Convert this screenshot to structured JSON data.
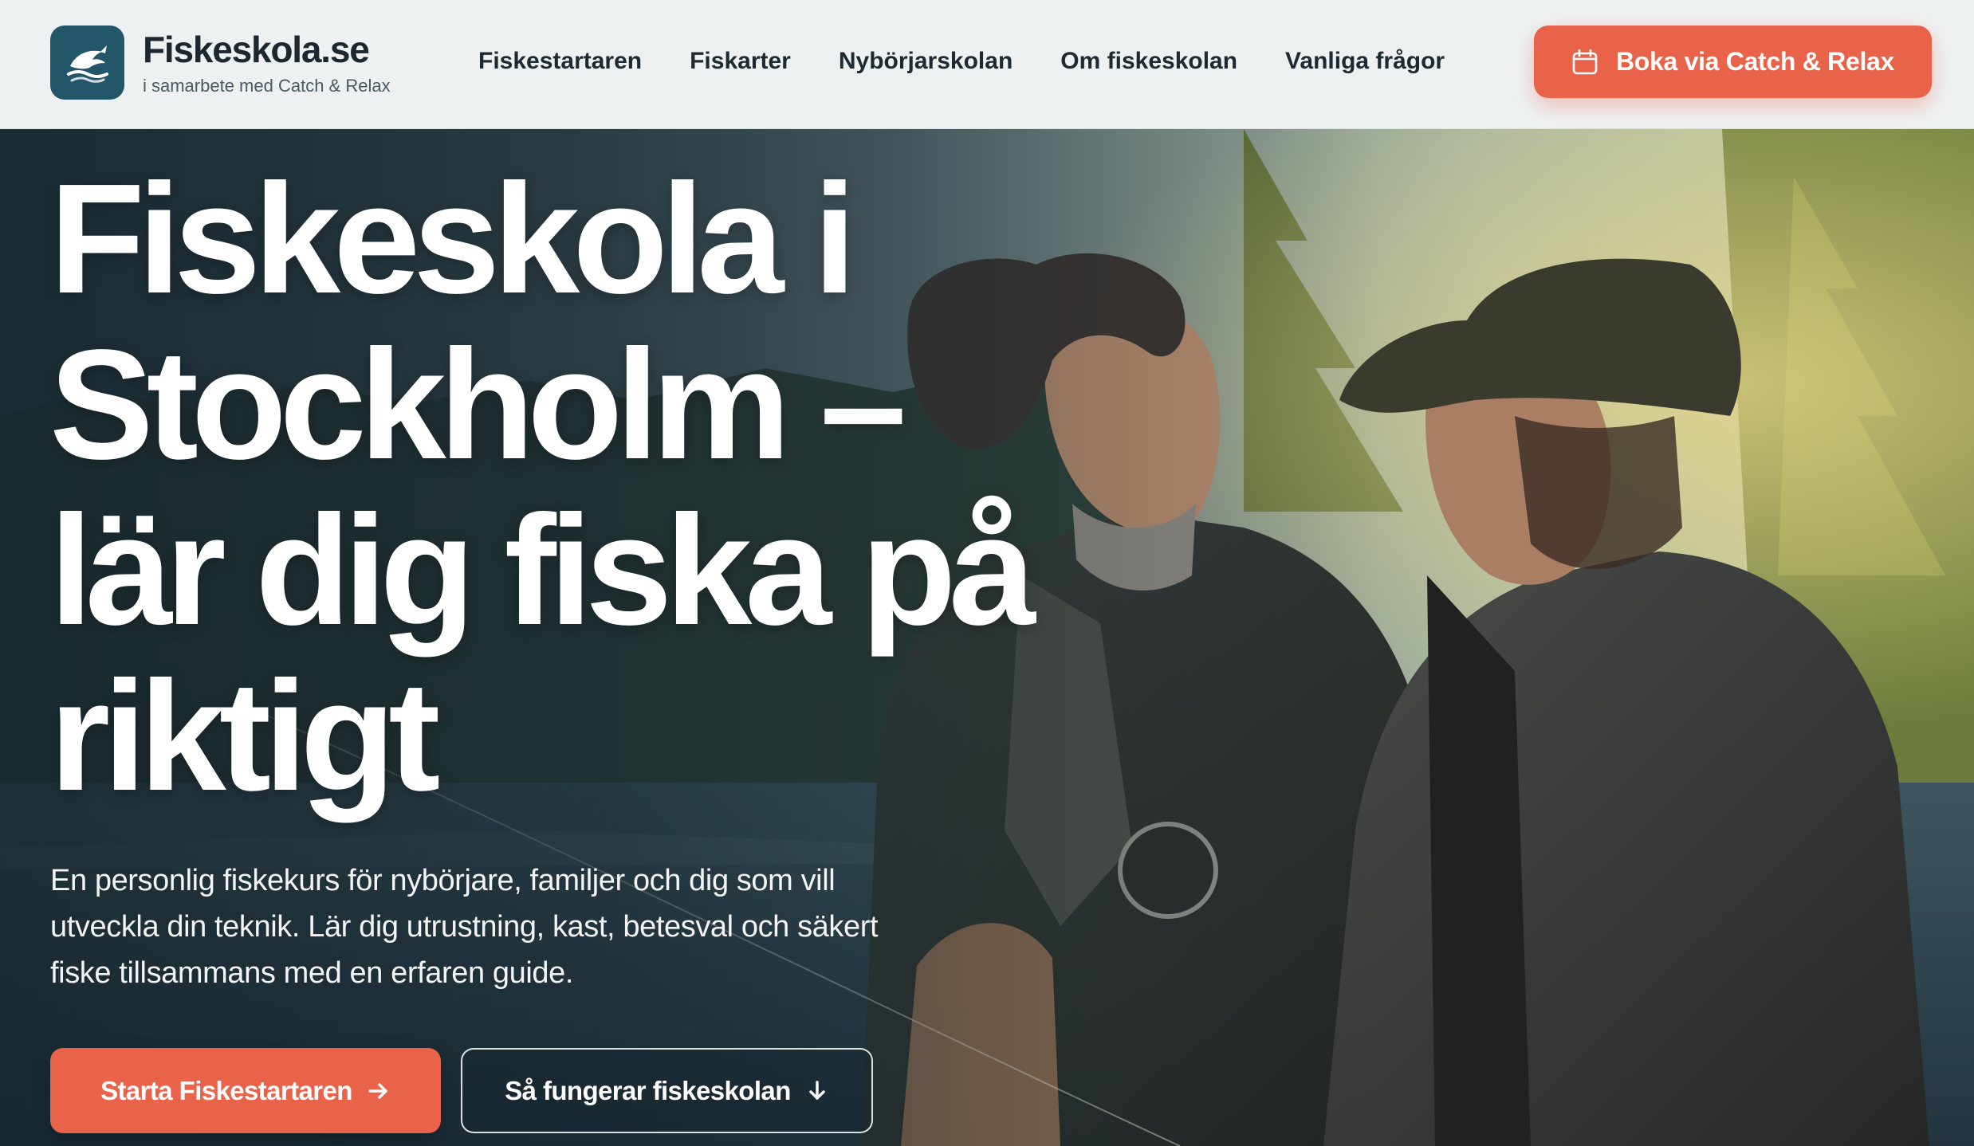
{
  "header": {
    "brand_name": "Fiskeskola.se",
    "tagline": "i samarbete med Catch & Relax",
    "logo_icon": "leaping-fish-icon",
    "nav": [
      {
        "label": "Fiskestartaren"
      },
      {
        "label": "Fiskarter"
      },
      {
        "label": "Nybörjarskolan"
      },
      {
        "label": "Om fiskeskolan"
      },
      {
        "label": "Vanliga frågor"
      }
    ],
    "book_button": {
      "label": "Boka via Catch & Relax",
      "icon": "calendar-icon"
    }
  },
  "hero": {
    "title": "Fiskeskola i Stockholm – lär dig fiska på riktigt",
    "description": "En personlig fiskekurs för nybörjare, familjer och dig som vill utveckla din teknik. Lär dig utrustning, kast, betesval och säkert fiske tillsammans med en erfaren guide.",
    "image_subject": "fishing-guide-teaching-young-angler-by-lake-photo",
    "primary_cta": {
      "label": "Starta Fiskestartaren",
      "icon": "arrow-right-icon"
    },
    "secondary_cta": {
      "label": "Så fungerar fiskeskolan",
      "icon": "arrow-down-icon"
    }
  },
  "colors": {
    "accent": "#e8634a",
    "brand_dark": "#24566a",
    "header_bg": "#eef1f2",
    "nav_text": "#1e2a31"
  }
}
